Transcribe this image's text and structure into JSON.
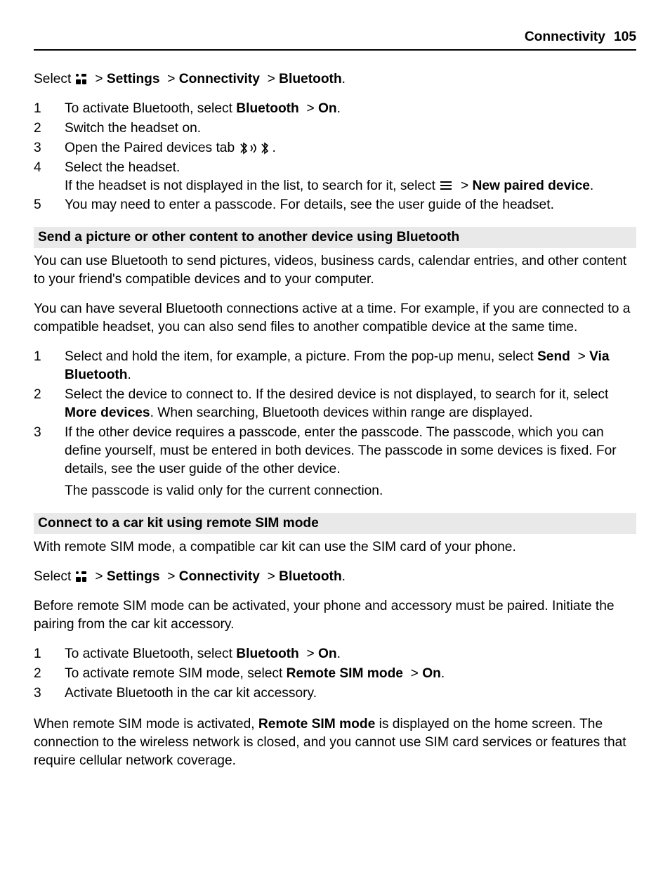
{
  "header": {
    "chapter": "Connectivity",
    "page": "105"
  },
  "nav1": {
    "select": "Select ",
    "settings": "Settings",
    "connectivity": "Connectivity",
    "bluetooth": "Bluetooth"
  },
  "listA": {
    "n1": "1",
    "t1a": "To activate Bluetooth, select ",
    "t1b": "Bluetooth",
    "t1c": "On",
    "n2": "2",
    "t2": "Switch the headset on.",
    "n3": "3",
    "t3": "Open the Paired devices tab ",
    "n4": "4",
    "t4a": "Select the headset.",
    "t4b": "If the headset is not displayed in the list, to search for it, select ",
    "t4c": "New paired device",
    "n5": "5",
    "t5": "You may need to enter a passcode. For details, see the user guide of the headset."
  },
  "sec2": {
    "title": "Send a picture or other content to another device using Bluetooth",
    "p1": "You can use Bluetooth to send pictures, videos, business cards, calendar entries, and other content to your friend's compatible devices and to your computer.",
    "p2": "You can have several Bluetooth connections active at a time. For example, if you are connected to a compatible headset, you can also send files to another compatible device at the same time.",
    "n1": "1",
    "t1a": "Select and hold the item, for example, a picture. From the pop-up menu, select ",
    "t1b": "Send",
    "t1c": "Via Bluetooth",
    "n2": "2",
    "t2a": "Select the device to connect to. If the desired device is not displayed, to search for it, select ",
    "t2b": "More devices",
    "t2c": ". When searching, Bluetooth devices within range are displayed.",
    "n3": "3",
    "t3a": "If the other device requires a passcode, enter the passcode. The passcode, which you can define yourself, must be entered in both devices. The passcode in some devices is fixed. For details, see the user guide of the other device.",
    "t3b": "The passcode is valid only for the current connection."
  },
  "sec3": {
    "title": "Connect to a car kit using remote SIM mode",
    "p1": "With remote SIM mode, a compatible car kit can use the SIM card of your phone.",
    "navSelect": "Select ",
    "navSettings": "Settings",
    "navConnectivity": "Connectivity",
    "navBluetooth": "Bluetooth",
    "p2": "Before remote SIM mode can be activated, your phone and accessory must be paired. Initiate the pairing from the car kit accessory.",
    "n1": "1",
    "t1a": "To activate Bluetooth, select ",
    "t1b": "Bluetooth",
    "t1c": "On",
    "n2": "2",
    "t2a": "To activate remote SIM mode, select ",
    "t2b": "Remote SIM mode",
    "t2c": "On",
    "n3": "3",
    "t3": "Activate Bluetooth in the car kit accessory.",
    "p3a": "When remote SIM mode is activated, ",
    "p3b": "Remote SIM mode",
    "p3c": " is displayed on the home screen. The connection to the wireless network is closed, and you cannot use SIM card services or features that require cellular network coverage."
  },
  "icons": {
    "menu": "menu-grid-icon",
    "btTabs": "bluetooth-paired-icon",
    "options": "options-list-icon"
  }
}
